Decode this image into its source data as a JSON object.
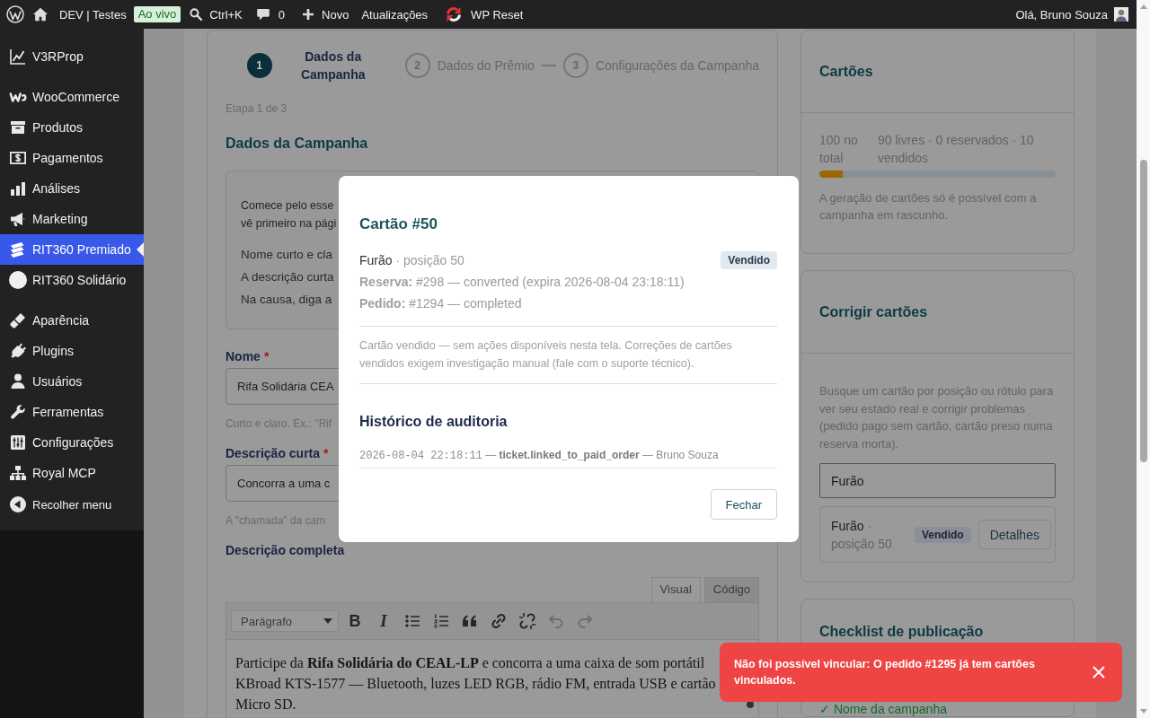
{
  "admin_bar": {
    "items": [
      {
        "kind": "logo"
      },
      {
        "kind": "site",
        "label": "DEV | Testes"
      },
      {
        "kind": "badge",
        "label": "Ao vivo"
      },
      {
        "kind": "search",
        "label": "Ctrl+K"
      },
      {
        "kind": "comments",
        "label": "0"
      },
      {
        "kind": "new",
        "label": "Novo"
      },
      {
        "kind": "link",
        "label": "Atualizações"
      },
      {
        "kind": "reset",
        "label": "WP Reset"
      }
    ],
    "greeting": "Olá, Bruno Souza"
  },
  "sidebar": {
    "groups": [
      {
        "items": [
          {
            "label": "V3RProp",
            "selected": false
          }
        ]
      },
      {
        "items": [
          {
            "label": "WooCommerce",
            "selected": false
          },
          {
            "label": "Produtos",
            "selected": false
          },
          {
            "label": "Pagamentos",
            "selected": false
          },
          {
            "label": "Análises",
            "selected": false
          },
          {
            "label": "Marketing",
            "selected": false
          },
          {
            "label": "RIT360 Premiado",
            "selected": true
          },
          {
            "label": "RIT360 Solidário",
            "selected": false
          }
        ]
      },
      {
        "items": [
          {
            "label": "Aparência",
            "selected": false
          },
          {
            "label": "Plugins",
            "selected": false
          },
          {
            "label": "Usuários",
            "selected": false
          },
          {
            "label": "Ferramentas",
            "selected": false
          },
          {
            "label": "Configurações",
            "selected": false
          },
          {
            "label": "Royal MCP",
            "selected": false
          }
        ]
      }
    ],
    "collapse": "Recolher menu"
  },
  "wizard": {
    "steps": [
      {
        "number": "1",
        "label": "Dados da Campanha",
        "selected": true
      },
      {
        "number": "2",
        "label": "Dados do Prêmio",
        "selected": false
      },
      {
        "number": "3",
        "label": "Configurações da Campanha",
        "selected": false
      }
    ],
    "step_counter": "Etapa 1 de 3",
    "section_title": "Dados da Campanha",
    "intro": {
      "lines": [
        "Comece pelo esse",
        "vê primeiro na pági"
      ],
      "tips": [
        "Nome curto e cla",
        "A descrição curta",
        "Na causa, diga a"
      ]
    },
    "fields": [
      {
        "kind": "input",
        "label": "Nome",
        "required_mark": "*",
        "value": "Rifa Solidária CEA",
        "hint": "Curto e claro. Ex.: \"Rif"
      },
      {
        "kind": "input",
        "label": "Descrição curta",
        "required_mark": "*",
        "value": "Concorra a uma c",
        "hint": "A \"chamada\" da cam"
      },
      {
        "kind": "editor",
        "label": "Descrição completa",
        "tabs": [
          {
            "label": "Visual",
            "selected": true
          },
          {
            "label": "Código",
            "selected": false
          }
        ],
        "format": "Parágrafo",
        "tools": [
          {
            "kind": "bold",
            "label": "B",
            "disabled": false
          },
          {
            "kind": "italic",
            "label": "I",
            "disabled": false
          },
          {
            "kind": "bullets",
            "disabled": false
          },
          {
            "kind": "numbers",
            "disabled": false
          },
          {
            "kind": "quote",
            "disabled": false
          },
          {
            "kind": "link",
            "disabled": false
          },
          {
            "kind": "unlink",
            "disabled": false
          },
          {
            "kind": "undo",
            "disabled": true
          },
          {
            "kind": "redo",
            "disabled": true
          }
        ],
        "content": "Participe da **Rifa Solidária do CEAL-LP** e concorra a uma caixa de som portátil KBroad KTS-1577 — Bluetooth, luzes LED RGB, rádio FM, entrada USB e cartão Micro SD."
      }
    ]
  },
  "cards_panel": {
    "title": "Cartões",
    "total": "100 no total",
    "breakdown": "90 livres · 0 reservados · 10 vendidos",
    "level": 0.1,
    "note": "A geração de cartões só é possível com a campanha em rascunho."
  },
  "fix_panel": {
    "title": "Corrigir cartões",
    "description": "Busque um cartão por posição ou rótulo para ver seu estado real e corrigir problemas (pedido pago sem cartão, cartão preso numa reserva morta).",
    "search_value": "Furão",
    "results": [
      {
        "label": "Furão",
        "position": "· posição 50",
        "status": "Vendido",
        "action": "Detalhes"
      }
    ]
  },
  "checklist_panel": {
    "title": "Checklist de publicação",
    "items": [
      {
        "text": "✓ Nome da campanha",
        "done": true
      }
    ]
  },
  "ticket_modal": {
    "title": "Cartão #50",
    "name": "Furão",
    "position": "· posição 50",
    "status": "Vendido",
    "details": [
      "**Reserva:** #298 — converted (expira 2026-08-04 23:18:11)",
      "**Pedido:** #1294 — completed"
    ],
    "note": "Cartão vendido — sem ações disponíveis nesta tela. Correções de cartões vendidos exigem investigação manual (fale com o suporte técnico).",
    "audit_title": "Histórico de auditoria",
    "audit": [
      {
        "time": "2026-08-04 22:18:11",
        "text": "— **ticket.linked_to_paid_order** — Bruno Souza"
      }
    ],
    "close": "Fechar"
  },
  "toast": {
    "kind": "error",
    "message": "Não foi possível vincular: O pedido #1295 já tem cartões vinculados."
  }
}
